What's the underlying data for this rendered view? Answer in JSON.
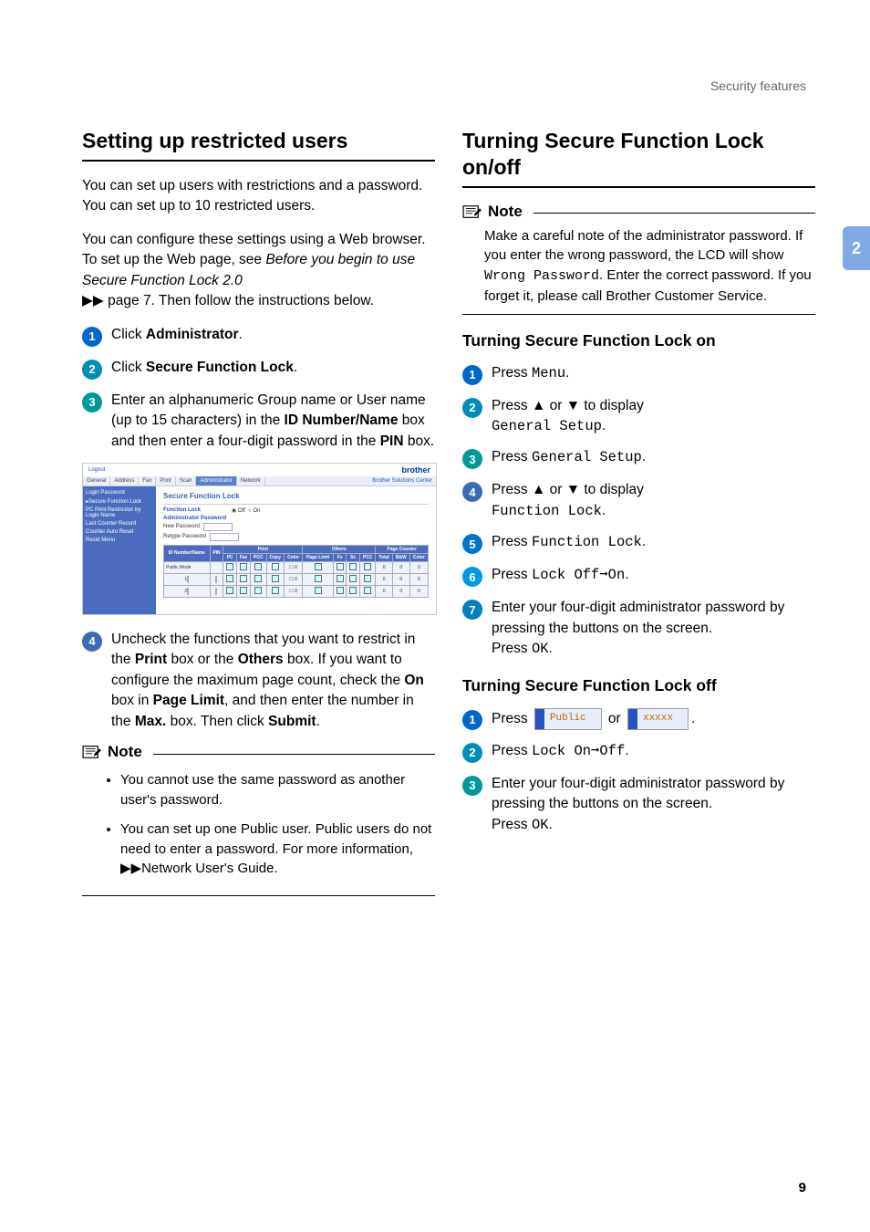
{
  "header": {
    "running": "Security features"
  },
  "sidetab": "2",
  "pagenum": "9",
  "left": {
    "h": "Setting up restricted users",
    "p1": "You can set up users with restrictions and a password. You can set up to 10 restricted users.",
    "p2a": "You can configure these settings using a Web browser.",
    "p2b_pre": "To set up the Web page, see ",
    "p2b_ref": "Before you begin to use Secure Function Lock 2.0",
    "p2b_post": " page 7. Then follow the instructions below.",
    "arrows": "▶▶",
    "s1_a": "Click ",
    "s1_b": "Administrator",
    "s1_c": ".",
    "s2_a": "Click ",
    "s2_b": "Secure Function Lock",
    "s2_c": ".",
    "s3_a": "Enter an alphanumeric Group name or User name (up to 15 characters) in the ",
    "s3_b": "ID Number/Name",
    "s3_c": " box and then enter a four-digit password in the ",
    "s3_d": "PIN",
    "s3_e": " box.",
    "s4_a": "Uncheck the functions that you want to restrict in the ",
    "s4_b": "Print",
    "s4_c": " box or the ",
    "s4_d": "Others",
    "s4_e": " box. If you want to configure the maximum page count, check the ",
    "s4_f": "On",
    "s4_g": " box in ",
    "s4_h": "Page Limit",
    "s4_i": ", and then enter the number in the ",
    "s4_j": "Max.",
    "s4_k": " box. Then click ",
    "s4_l": "Submit",
    "s4_m": ".",
    "note_label": "Note",
    "note_b1": "You cannot use the same password as another user's password.",
    "note_b2_a": "You can set up one Public user. Public users do not need to enter a password. For more information,",
    "note_b2_b": "Network User's Guide.",
    "scr": {
      "logout": "Logout",
      "brand": "brother",
      "sol": "Brother Solutions Center",
      "tabs": [
        "General",
        "Address",
        "Fax",
        "Print",
        "Scan",
        "Administrator",
        "Network"
      ],
      "side": [
        "Login Password",
        "▸Secure Function Lock",
        "PC Print Restriction by Login Name",
        "Last Counter Record",
        "Counter Auto Reset",
        "Reset Menu"
      ],
      "title": "Secure Function Lock",
      "flock": "Function Lock",
      "off": "Off",
      "on": "On",
      "admpw": "Administrator Password",
      "newpw": "New Password",
      "retpw": "Retype Password",
      "th_id": "ID Number/Name",
      "th_pin": "PIN",
      "th_print": "Print",
      "th_pl": "Page Limit",
      "th_oth": "Others",
      "th_pc": "Page Counter",
      "public": "Public Mode"
    }
  },
  "right": {
    "h": "Turning Secure Function Lock on/off",
    "note_label": "Note",
    "note_body_a": "Make a careful note of the administrator password. If you enter the wrong password, the LCD will show ",
    "note_body_mono": "Wrong Password",
    "note_body_b": ". Enter the correct password. If you forget it, please call Brother Customer Service.",
    "sub_on": "Turning Secure Function Lock on",
    "on1_a": "Press ",
    "on1_mono": "Menu",
    "on1_b": ".",
    "on2_a": "Press ",
    "up": "▲",
    "or_word": " or ",
    "down": "▼",
    "on2_b": " to display ",
    "on2_mono": "General Setup",
    "period": ".",
    "on3_a": "Press ",
    "on3_mono": "General Setup",
    "on4_b": " to display ",
    "on4_mono": "Function Lock",
    "on5_a": "Press ",
    "on5_mono": "Function Lock",
    "on6_a": "Press ",
    "on6_mono": "Lock Off➞On",
    "on7": "Enter your four-digit administrator password by pressing the buttons on the screen.",
    "on7b": "Press ",
    "on7_mono": "OK",
    "sub_off": "Turning Secure Function Lock off",
    "off1_a": "Press ",
    "off1_or": " or ",
    "lcd1": "Public",
    "lcd2": "xxxxx",
    "off2_a": "Press ",
    "off2_mono": "Lock On➞Off",
    "off3": "Enter your four-digit administrator password by pressing the buttons on the screen.",
    "off3b": "Press ",
    "off3_mono": "OK"
  }
}
